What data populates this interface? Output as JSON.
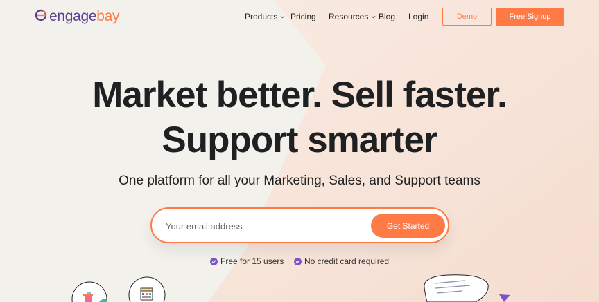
{
  "brand": {
    "part1": "engage",
    "part2": "bay",
    "accent": "#ff7a45",
    "purple": "#5b3f8f"
  },
  "nav": {
    "items": [
      {
        "label": "Products",
        "dropdown": true
      },
      {
        "label": "Pricing",
        "dropdown": false
      },
      {
        "label": "Resources",
        "dropdown": true
      },
      {
        "label": "Blog",
        "dropdown": false
      },
      {
        "label": "Login",
        "dropdown": false
      }
    ],
    "demo_label": "Demo",
    "signup_label": "Free Signup"
  },
  "hero": {
    "line1": "Market better. Sell faster.",
    "line2": "Support smarter",
    "subtitle": "One platform for all your Marketing, Sales, and Support teams"
  },
  "signup_form": {
    "email_placeholder": "Your email address",
    "email_value": "",
    "button_label": "Get Started"
  },
  "badges": [
    {
      "label": "Free for 15 users",
      "icon": "check-circle-icon"
    },
    {
      "label": "No credit card required",
      "icon": "check-circle-icon"
    }
  ],
  "colors": {
    "check": "#7a55c7",
    "heading": "#1e2022",
    "background": "#f4f1ec",
    "shape": "#f7e2d6"
  }
}
